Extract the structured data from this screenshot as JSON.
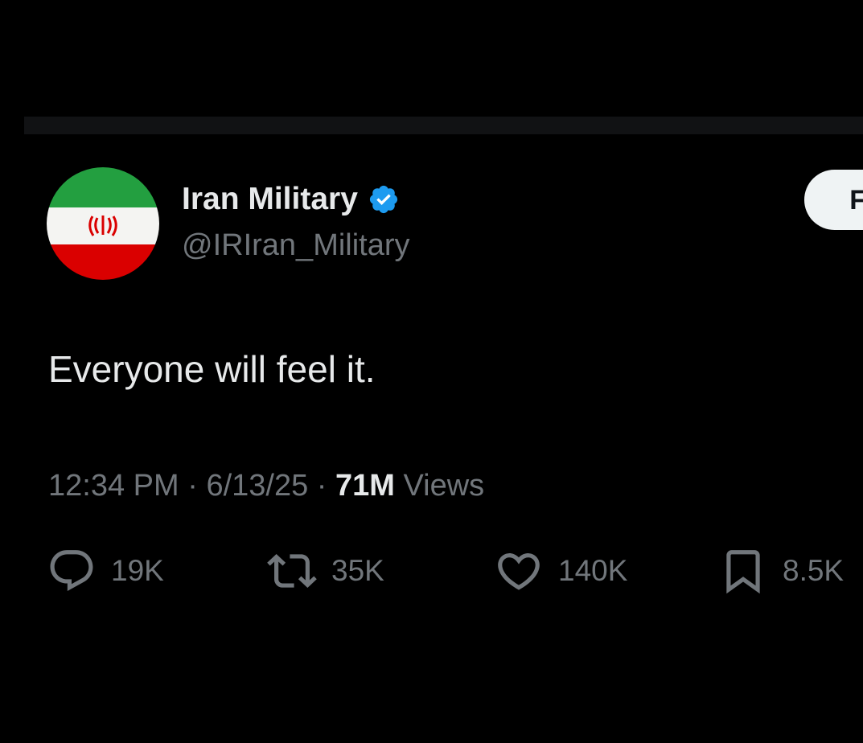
{
  "tweet": {
    "author": {
      "display_name": "Iran Military",
      "handle": "@IRIran_Military",
      "verified": true,
      "avatar_icon": "iran-flag-avatar"
    },
    "follow_label": "Fo",
    "text": "Everyone will feel it.",
    "meta": {
      "time": "12:34 PM",
      "separator": "·",
      "date": "6/13/25",
      "views_count": "71M",
      "views_label": "Views"
    },
    "actions": {
      "replies": "19K",
      "reposts": "35K",
      "likes": "140K",
      "bookmarks": "8.5K"
    }
  },
  "colors": {
    "background": "#000000",
    "primary_text": "#e7e9ea",
    "secondary_text": "#71767b",
    "verified_blue": "#1d9bf0",
    "follow_bg": "#eff3f4"
  }
}
